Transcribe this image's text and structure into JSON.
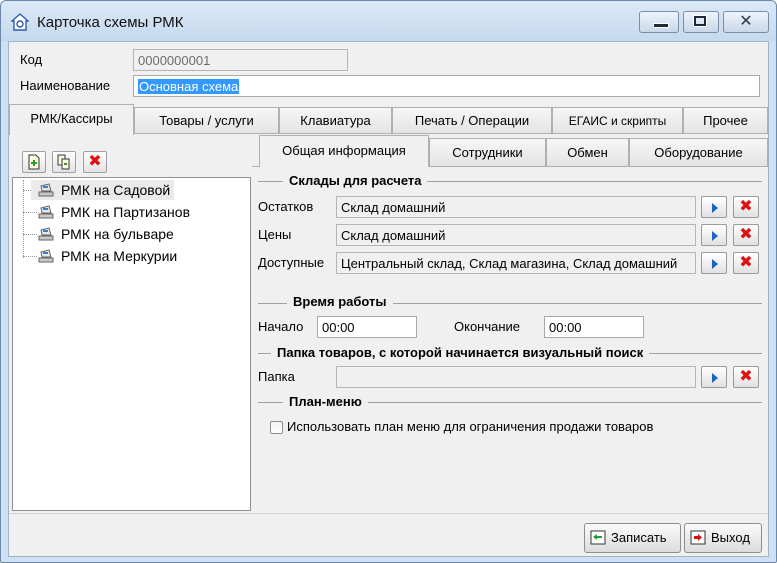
{
  "window": {
    "title": "Карточка схемы РМК"
  },
  "header": {
    "code_label": "Код",
    "code_value": "0000000001",
    "name_label": "Наименование",
    "name_value": "Основная схема"
  },
  "main_tabs": [
    {
      "label": "РМК/Кассиры",
      "active": true
    },
    {
      "label": "Товары / услуги"
    },
    {
      "label": "Клавиатура"
    },
    {
      "label": "Печать / Операции"
    },
    {
      "label": "ЕГАИС и скрипты"
    },
    {
      "label": "Прочее"
    }
  ],
  "tree": {
    "items": [
      {
        "label": "РМК на Садовой",
        "selected": true
      },
      {
        "label": "РМК на Партизанов"
      },
      {
        "label": "РМК на бульваре"
      },
      {
        "label": "РМК на Меркурии"
      }
    ]
  },
  "sub_tabs": [
    {
      "label": "Общая информация",
      "active": true
    },
    {
      "label": "Сотрудники"
    },
    {
      "label": "Обмен"
    },
    {
      "label": "Оборудование"
    }
  ],
  "warehouses": {
    "heading": "Склады для расчета",
    "rows": [
      {
        "label": "Остатков",
        "value": "Склад домашний"
      },
      {
        "label": "Цены",
        "value": "Склад домашний"
      },
      {
        "label": "Доступные",
        "value": "Центральный склад, Склад магазина, Склад домашний"
      }
    ]
  },
  "work_time": {
    "heading": "Время работы",
    "start_label": "Начало",
    "start_value": "00:00",
    "end_label": "Окончание",
    "end_value": "00:00"
  },
  "folder": {
    "heading": "Папка товаров, с которой начинается визуальный поиск",
    "label": "Папка",
    "value": ""
  },
  "plan_menu": {
    "heading": "План-меню",
    "checkbox_label": "Использовать план меню для ограничения продажи товаров",
    "checked": false
  },
  "footer": {
    "save_label": "Записать",
    "exit_label": "Выход"
  },
  "colors": {
    "accent_blue": "#1a63c7",
    "delete_red": "#dd1111",
    "selection": "#3399ff"
  }
}
